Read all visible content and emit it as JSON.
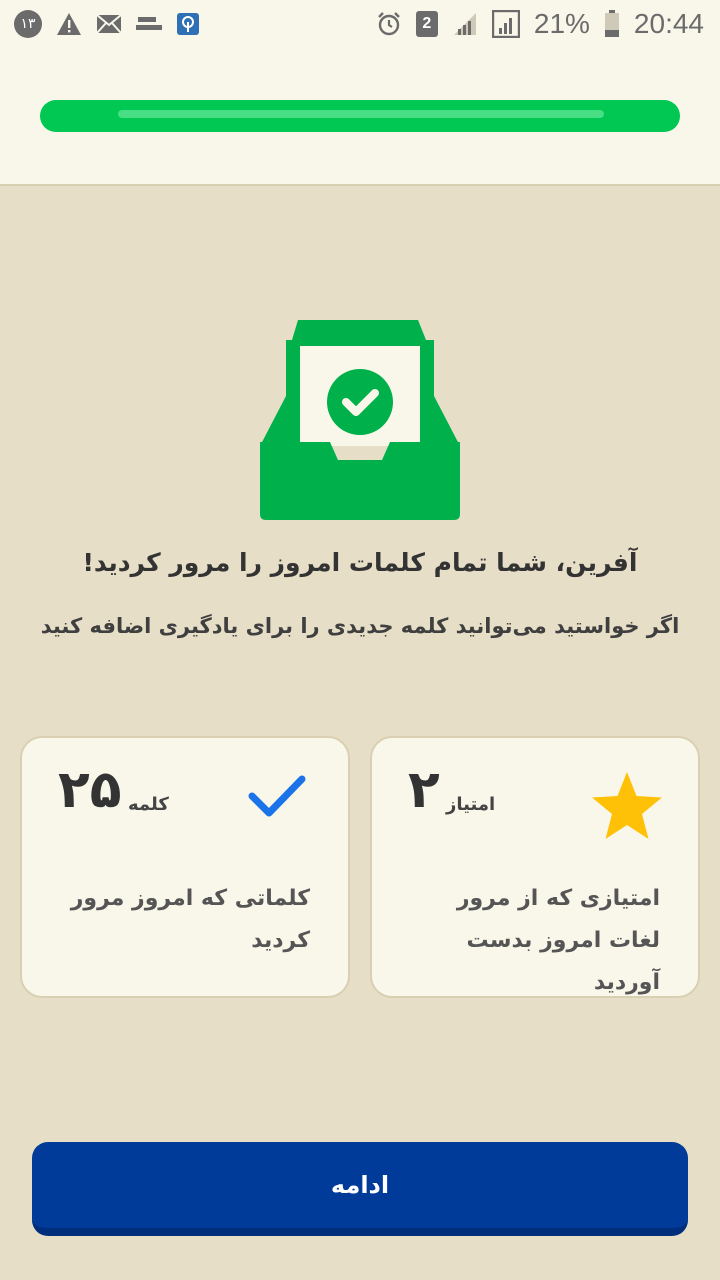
{
  "status_bar": {
    "notification_count": "۱۳",
    "sim_label": "2",
    "battery": "21%",
    "time": "20:44"
  },
  "progress": {
    "value": 1.0
  },
  "message": {
    "title": "آفرین، شما تمام کلمات امروز را مرور کردید!",
    "subtitle": "اگر خواستید می‌توانید کلمه جدیدی را برای یادگیری اضافه کنید"
  },
  "stats": {
    "points": {
      "value": "۲",
      "unit": "امتیاز",
      "description": "امتیازی که از مرور لغات امروز بدست آوردید",
      "icon": "star-icon",
      "color": "#ffc107"
    },
    "words": {
      "value": "۲۵",
      "unit": "کلمه",
      "description": "کلماتی که امروز مرور کردید",
      "icon": "checkmark-icon",
      "color": "#1a73e8"
    }
  },
  "continue_button": {
    "label": "ادامه"
  },
  "colors": {
    "accent_green": "#00b04a",
    "progress_green": "#00c853",
    "button_blue": "#003b9a",
    "background": "#e6dec6",
    "card": "#f9f7ea"
  }
}
